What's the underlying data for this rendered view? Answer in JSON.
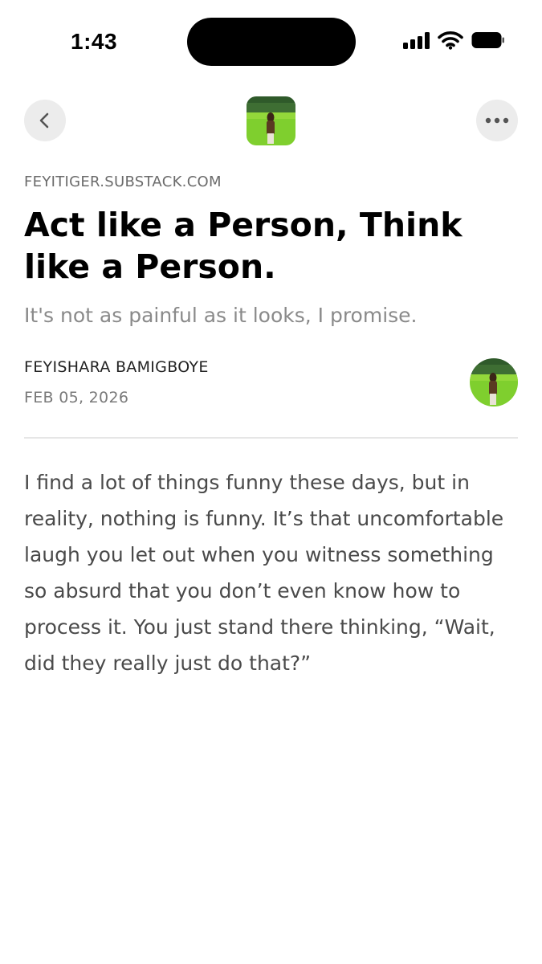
{
  "status_bar": {
    "time": "1:43",
    "icons": [
      "signal-icon",
      "wifi-icon",
      "battery-icon"
    ]
  },
  "nav": {
    "back_icon": "chevron-left-icon",
    "more_icon": "ellipsis-icon",
    "publication_logo": "publication-logo"
  },
  "post": {
    "domain": "FEYITIGER.SUBSTACK.COM",
    "title": "Act like a Person, Think like a Person.",
    "subtitle": "It's not as painful as it looks, I promise.",
    "author": "FEYISHARA BAMIGBOYE",
    "date": "FEB 05, 2026",
    "body": "I find a lot of things funny these days, but in reality, nothing is funny. It’s that uncomfortable laugh you let out when you witness something so absurd that you don’t even know how to process it. You just stand there thinking, “Wait, did they really just do that?”"
  },
  "colors": {
    "button_bg": "#ececec",
    "muted_text": "#8a8a8a",
    "body_text": "#4a4a4a",
    "divider": "#e6e6e6"
  }
}
